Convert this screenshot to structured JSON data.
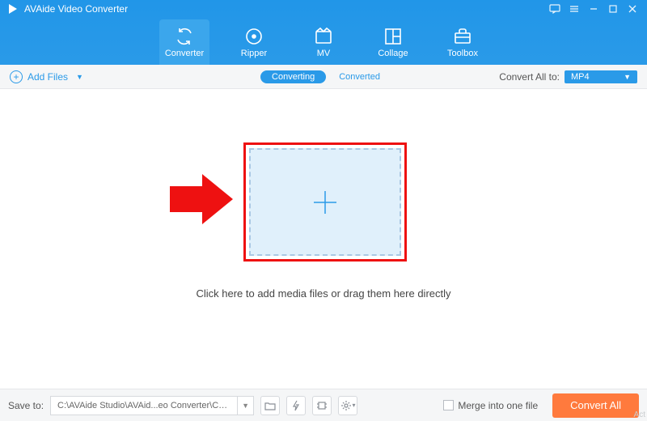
{
  "app": {
    "title": "AVAide Video Converter"
  },
  "tabs": [
    {
      "id": "converter",
      "label": "Converter"
    },
    {
      "id": "ripper",
      "label": "Ripper"
    },
    {
      "id": "mv",
      "label": "MV"
    },
    {
      "id": "collage",
      "label": "Collage"
    },
    {
      "id": "toolbox",
      "label": "Toolbox"
    }
  ],
  "subbar": {
    "add_files": "Add Files",
    "converting": "Converting",
    "converted": "Converted",
    "convert_all_to": "Convert All to:",
    "format": "MP4"
  },
  "main": {
    "drop_text": "Click here to add media files or drag them here directly"
  },
  "footer": {
    "save_to_label": "Save to:",
    "save_path": "C:\\AVAide Studio\\AVAid...eo Converter\\Converted",
    "merge_label": "Merge into one file",
    "convert_button": "Convert All"
  },
  "watermark": "Act"
}
